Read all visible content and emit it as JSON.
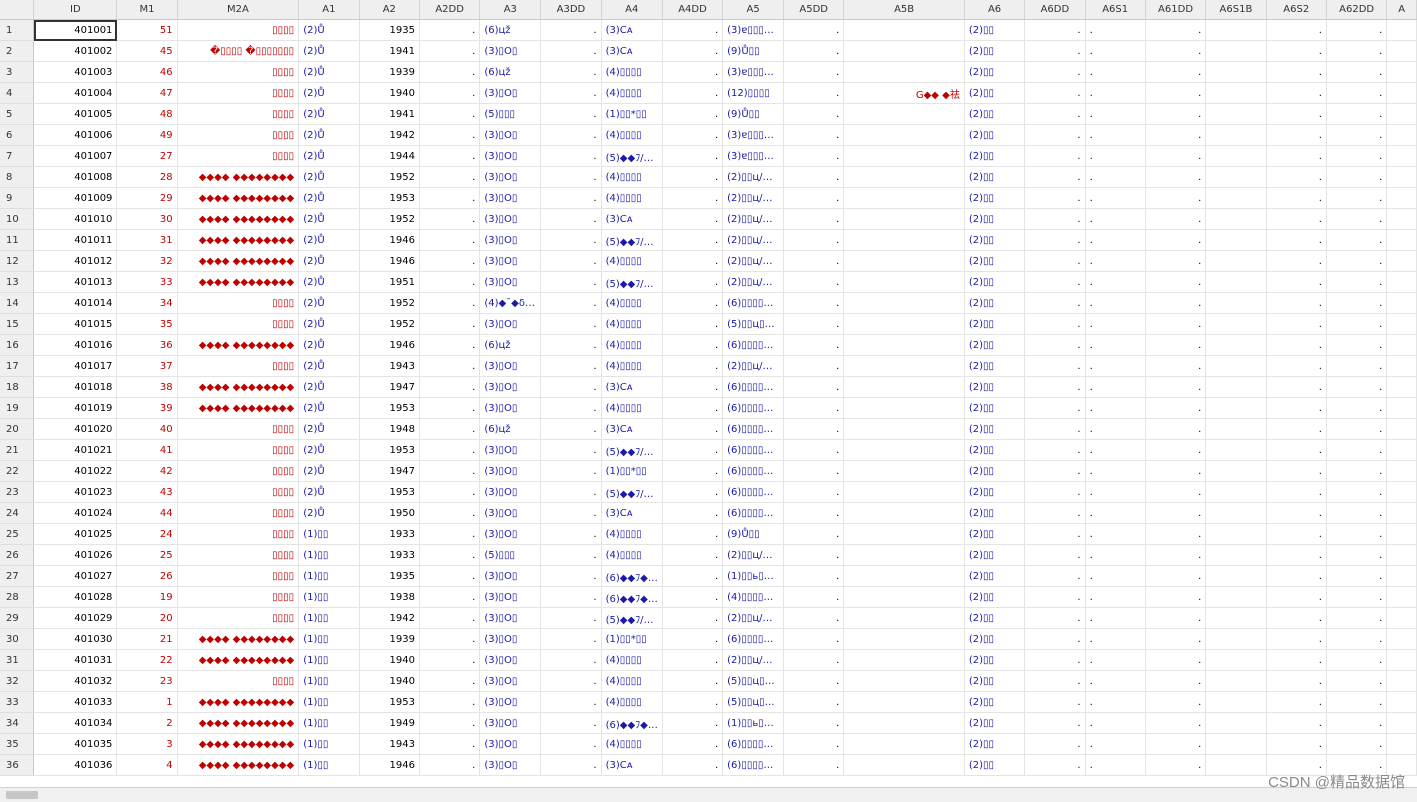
{
  "columns": [
    "",
    "ID",
    "M1",
    "M2A",
    "A1",
    "A2",
    "A2DD",
    "A3",
    "A3DD",
    "A4",
    "A4DD",
    "A5",
    "A5DD",
    "A5B",
    "A6",
    "A6DD",
    "A6S1",
    "A61DD",
    "A6S1B",
    "A6S2",
    "A62DD",
    "A"
  ],
  "rows": [
    [
      "1",
      "401001",
      "51",
      "▯▯▯▯",
      "(2)Ů",
      "1935",
      ".",
      "(6)цž",
      ".",
      "(3)Cᴀ",
      ".",
      "(3)ɐ▯▯▯…",
      ".",
      "",
      "(2)▯▯",
      ".",
      ".",
      ".",
      "",
      ".",
      "."
    ],
    [
      "2",
      "401002",
      "45",
      "�▯▯▯▯ �▯▯▯▯▯▯▯",
      "(2)Ů",
      "1941",
      ".",
      "(3)▯О▯",
      ".",
      "(3)Cᴀ",
      ".",
      "(9)Ů▯▯",
      ".",
      "",
      "(2)▯▯",
      ".",
      ".",
      ".",
      "",
      ".",
      "."
    ],
    [
      "3",
      "401003",
      "46",
      "▯▯▯▯",
      "(2)Ů",
      "1939",
      ".",
      "(6)цž",
      ".",
      "(4)▯▯▯▯",
      ".",
      "(3)ɐ▯▯▯…",
      ".",
      "",
      "(2)▯▯",
      ".",
      ".",
      ".",
      "",
      ".",
      "."
    ],
    [
      "4",
      "401004",
      "47",
      "▯▯▯▯",
      "(2)Ů",
      "1940",
      ".",
      "(3)▯О▯",
      ".",
      "(4)▯▯▯▯",
      ".",
      "(12)▯▯▯▯",
      ".",
      "G◆◆ ◆祛",
      "(2)▯▯",
      ".",
      ".",
      ".",
      "",
      ".",
      "."
    ],
    [
      "5",
      "401005",
      "48",
      "▯▯▯▯",
      "(2)Ů",
      "1941",
      ".",
      "(5)▯▯▯",
      ".",
      "(1)▯▯*▯▯",
      ".",
      "(9)Ů▯▯",
      ".",
      "",
      "(2)▯▯",
      ".",
      ".",
      ".",
      "",
      ".",
      "."
    ],
    [
      "6",
      "401006",
      "49",
      "▯▯▯▯",
      "(2)Ů",
      "1942",
      ".",
      "(3)▯О▯",
      ".",
      "(4)▯▯▯▯",
      ".",
      "(3)ɐ▯▯▯…",
      ".",
      "",
      "(2)▯▯",
      ".",
      ".",
      ".",
      "",
      ".",
      "."
    ],
    [
      "7",
      "401007",
      "27",
      "▯▯▯▯",
      "(2)Ů",
      "1944",
      ".",
      "(3)▯О▯",
      ".",
      "(5)◆◆ﾌ/…",
      ".",
      "(3)ɐ▯▯▯…",
      ".",
      "",
      "(2)▯▯",
      ".",
      ".",
      ".",
      "",
      ".",
      "."
    ],
    [
      "8",
      "401008",
      "28",
      "◆◆◆◆ ◆◆◆◆◆◆◆◆",
      "(2)Ů",
      "1952",
      ".",
      "(3)▯О▯",
      ".",
      "(4)▯▯▯▯",
      ".",
      "(2)▯▯ц/…",
      ".",
      "",
      "(2)▯▯",
      ".",
      ".",
      ".",
      "",
      ".",
      "."
    ],
    [
      "9",
      "401009",
      "29",
      "◆◆◆◆ ◆◆◆◆◆◆◆◆",
      "(2)Ů",
      "1953",
      ".",
      "(3)▯О▯",
      ".",
      "(4)▯▯▯▯",
      ".",
      "(2)▯▯ц/…",
      ".",
      "",
      "(2)▯▯",
      ".",
      ".",
      ".",
      "",
      ".",
      "."
    ],
    [
      "10",
      "401010",
      "30",
      "◆◆◆◆ ◆◆◆◆◆◆◆◆",
      "(2)Ů",
      "1952",
      ".",
      "(3)▯О▯",
      ".",
      "(3)Cᴀ",
      ".",
      "(2)▯▯ц/…",
      ".",
      "",
      "(2)▯▯",
      ".",
      ".",
      ".",
      "",
      ".",
      "."
    ],
    [
      "11",
      "401011",
      "31",
      "◆◆◆◆ ◆◆◆◆◆◆◆◆",
      "(2)Ů",
      "1946",
      ".",
      "(3)▯О▯",
      ".",
      "(5)◆◆ﾌ/…",
      ".",
      "(2)▯▯ц/…",
      ".",
      "",
      "(2)▯▯",
      ".",
      ".",
      ".",
      "",
      ".",
      "."
    ],
    [
      "12",
      "401012",
      "32",
      "◆◆◆◆ ◆◆◆◆◆◆◆◆",
      "(2)Ů",
      "1946",
      ".",
      "(3)▯О▯",
      ".",
      "(4)▯▯▯▯",
      ".",
      "(2)▯▯ц/…",
      ".",
      "",
      "(2)▯▯",
      ".",
      ".",
      ".",
      "",
      ".",
      "."
    ],
    [
      "13",
      "401013",
      "33",
      "◆◆◆◆ ◆◆◆◆◆◆◆◆",
      "(2)Ů",
      "1951",
      ".",
      "(3)▯О▯",
      ".",
      "(5)◆◆ﾌ/…",
      ".",
      "(2)▯▯ц/…",
      ".",
      "",
      "(2)▯▯",
      ".",
      ".",
      ".",
      "",
      ".",
      "."
    ],
    [
      "14",
      "401014",
      "34",
      "▯▯▯▯",
      "(2)Ů",
      "1952",
      ".",
      "(4)◆¯◆δ…",
      ".",
      "(4)▯▯▯▯",
      ".",
      "(6)▯▯▯▯…",
      ".",
      "",
      "(2)▯▯",
      ".",
      ".",
      ".",
      "",
      ".",
      "."
    ],
    [
      "15",
      "401015",
      "35",
      "▯▯▯▯",
      "(2)Ů",
      "1952",
      ".",
      "(3)▯О▯",
      ".",
      "(4)▯▯▯▯",
      ".",
      "(5)▯▯ц▯…",
      ".",
      "",
      "(2)▯▯",
      ".",
      ".",
      ".",
      "",
      ".",
      "."
    ],
    [
      "16",
      "401016",
      "36",
      "◆◆◆◆ ◆◆◆◆◆◆◆◆",
      "(2)Ů",
      "1946",
      ".",
      "(6)цž",
      ".",
      "(4)▯▯▯▯",
      ".",
      "(6)▯▯▯▯…",
      ".",
      "",
      "(2)▯▯",
      ".",
      ".",
      ".",
      "",
      ".",
      "."
    ],
    [
      "17",
      "401017",
      "37",
      "▯▯▯▯",
      "(2)Ů",
      "1943",
      ".",
      "(3)▯О▯",
      ".",
      "(4)▯▯▯▯",
      ".",
      "(2)▯▯ц/…",
      ".",
      "",
      "(2)▯▯",
      ".",
      ".",
      ".",
      "",
      ".",
      "."
    ],
    [
      "18",
      "401018",
      "38",
      "◆◆◆◆ ◆◆◆◆◆◆◆◆",
      "(2)Ů",
      "1947",
      ".",
      "(3)▯О▯",
      ".",
      "(3)Cᴀ",
      ".",
      "(6)▯▯▯▯…",
      ".",
      "",
      "(2)▯▯",
      ".",
      ".",
      ".",
      "",
      ".",
      "."
    ],
    [
      "19",
      "401019",
      "39",
      "◆◆◆◆ ◆◆◆◆◆◆◆◆",
      "(2)Ů",
      "1953",
      ".",
      "(3)▯О▯",
      ".",
      "(4)▯▯▯▯",
      ".",
      "(6)▯▯▯▯…",
      ".",
      "",
      "(2)▯▯",
      ".",
      ".",
      ".",
      "",
      ".",
      "."
    ],
    [
      "20",
      "401020",
      "40",
      "▯▯▯▯",
      "(2)Ů",
      "1948",
      ".",
      "(6)цž",
      ".",
      "(3)Cᴀ",
      ".",
      "(6)▯▯▯▯…",
      ".",
      "",
      "(2)▯▯",
      ".",
      ".",
      ".",
      "",
      ".",
      "."
    ],
    [
      "21",
      "401021",
      "41",
      "▯▯▯▯",
      "(2)Ů",
      "1953",
      ".",
      "(3)▯О▯",
      ".",
      "(5)◆◆ﾌ/…",
      ".",
      "(6)▯▯▯▯…",
      ".",
      "",
      "(2)▯▯",
      ".",
      ".",
      ".",
      "",
      ".",
      "."
    ],
    [
      "22",
      "401022",
      "42",
      "▯▯▯▯",
      "(2)Ů",
      "1947",
      ".",
      "(3)▯О▯",
      ".",
      "(1)▯▯*▯▯",
      ".",
      "(6)▯▯▯▯…",
      ".",
      "",
      "(2)▯▯",
      ".",
      ".",
      ".",
      "",
      ".",
      "."
    ],
    [
      "23",
      "401023",
      "43",
      "▯▯▯▯",
      "(2)Ů",
      "1953",
      ".",
      "(3)▯О▯",
      ".",
      "(5)◆◆ﾌ/…",
      ".",
      "(6)▯▯▯▯…",
      ".",
      "",
      "(2)▯▯",
      ".",
      ".",
      ".",
      "",
      ".",
      "."
    ],
    [
      "24",
      "401024",
      "44",
      "▯▯▯▯",
      "(2)Ů",
      "1950",
      ".",
      "(3)▯О▯",
      ".",
      "(3)Cᴀ",
      ".",
      "(6)▯▯▯▯…",
      ".",
      "",
      "(2)▯▯",
      ".",
      ".",
      ".",
      "",
      ".",
      "."
    ],
    [
      "25",
      "401025",
      "24",
      "▯▯▯▯",
      "(1)▯▯",
      "1933",
      ".",
      "(3)▯О▯",
      ".",
      "(4)▯▯▯▯",
      ".",
      "(9)Ů▯▯",
      ".",
      "",
      "(2)▯▯",
      ".",
      ".",
      ".",
      "",
      ".",
      "."
    ],
    [
      "26",
      "401026",
      "25",
      "▯▯▯▯",
      "(1)▯▯",
      "1933",
      ".",
      "(5)▯▯▯",
      ".",
      "(4)▯▯▯▯",
      ".",
      "(2)▯▯ц/…",
      ".",
      "",
      "(2)▯▯",
      ".",
      ".",
      ".",
      "",
      ".",
      "."
    ],
    [
      "27",
      "401027",
      "26",
      "▯▯▯▯",
      "(1)▯▯",
      "1935",
      ".",
      "(3)▯О▯",
      ".",
      "(6)◆◆ﾌ◆…",
      ".",
      "(1)▯▯ь▯…",
      ".",
      "",
      "(2)▯▯",
      ".",
      ".",
      ".",
      "",
      ".",
      "."
    ],
    [
      "28",
      "401028",
      "19",
      "▯▯▯▯",
      "(1)▯▯",
      "1938",
      ".",
      "(3)▯О▯",
      ".",
      "(6)◆◆ﾌ◆…",
      ".",
      "(4)▯▯▯▯…",
      ".",
      "",
      "(2)▯▯",
      ".",
      ".",
      ".",
      "",
      ".",
      "."
    ],
    [
      "29",
      "401029",
      "20",
      "▯▯▯▯",
      "(1)▯▯",
      "1942",
      ".",
      "(3)▯О▯",
      ".",
      "(5)◆◆ﾌ/…",
      ".",
      "(2)▯▯ц/…",
      ".",
      "",
      "(2)▯▯",
      ".",
      ".",
      ".",
      "",
      ".",
      "."
    ],
    [
      "30",
      "401030",
      "21",
      "◆◆◆◆ ◆◆◆◆◆◆◆◆",
      "(1)▯▯",
      "1939",
      ".",
      "(3)▯О▯",
      ".",
      "(1)▯▯*▯▯",
      ".",
      "(6)▯▯▯▯…",
      ".",
      "",
      "(2)▯▯",
      ".",
      ".",
      ".",
      "",
      ".",
      "."
    ],
    [
      "31",
      "401031",
      "22",
      "◆◆◆◆ ◆◆◆◆◆◆◆◆",
      "(1)▯▯",
      "1940",
      ".",
      "(3)▯О▯",
      ".",
      "(4)▯▯▯▯",
      ".",
      "(2)▯▯ц/…",
      ".",
      "",
      "(2)▯▯",
      ".",
      ".",
      ".",
      "",
      ".",
      "."
    ],
    [
      "32",
      "401032",
      "23",
      "▯▯▯▯",
      "(1)▯▯",
      "1940",
      ".",
      "(3)▯О▯",
      ".",
      "(4)▯▯▯▯",
      ".",
      "(5)▯▯ц▯…",
      ".",
      "",
      "(2)▯▯",
      ".",
      ".",
      ".",
      "",
      ".",
      "."
    ],
    [
      "33",
      "401033",
      "1",
      "◆◆◆◆ ◆◆◆◆◆◆◆◆",
      "(1)▯▯",
      "1953",
      ".",
      "(3)▯О▯",
      ".",
      "(4)▯▯▯▯",
      ".",
      "(5)▯▯ц▯…",
      ".",
      "",
      "(2)▯▯",
      ".",
      ".",
      ".",
      "",
      ".",
      "."
    ],
    [
      "34",
      "401034",
      "2",
      "◆◆◆◆ ◆◆◆◆◆◆◆◆",
      "(1)▯▯",
      "1949",
      ".",
      "(3)▯О▯",
      ".",
      "(6)◆◆ﾌ◆…",
      ".",
      "(1)▯▯ь▯…",
      ".",
      "",
      "(2)▯▯",
      ".",
      ".",
      ".",
      "",
      ".",
      "."
    ],
    [
      "35",
      "401035",
      "3",
      "◆◆◆◆ ◆◆◆◆◆◆◆◆",
      "(1)▯▯",
      "1943",
      ".",
      "(3)▯О▯",
      ".",
      "(4)▯▯▯▯",
      ".",
      "(6)▯▯▯▯…",
      ".",
      "",
      "(2)▯▯",
      ".",
      ".",
      ".",
      "",
      ".",
      "."
    ],
    [
      "36",
      "401036",
      "4",
      "◆◆◆◆ ◆◆◆◆◆◆◆◆",
      "(1)▯▯",
      "1946",
      ".",
      "(3)▯О▯",
      ".",
      "(3)Cᴀ",
      ".",
      "(6)▯▯▯▯…",
      ".",
      "",
      "(2)▯▯",
      ".",
      ".",
      ".",
      "",
      ".",
      "."
    ]
  ],
  "watermark": "CSDN @精品数据馆",
  "colors": {
    "label_text": "#1a1aa6",
    "string_text": "#c00000",
    "header_bg": "#efefef"
  }
}
